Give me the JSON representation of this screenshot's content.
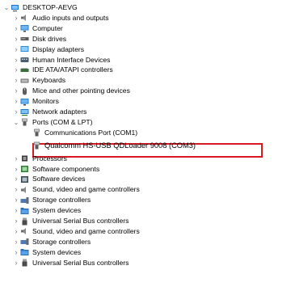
{
  "device_manager": {
    "root": {
      "label": "DESKTOP-AEVG",
      "icon": "computer-icon",
      "expanded": true
    },
    "items": [
      {
        "label": "Audio inputs and outputs",
        "icon": "speaker-icon",
        "expanded": false
      },
      {
        "label": "Computer",
        "icon": "monitor-icon",
        "expanded": false
      },
      {
        "label": "Disk drives",
        "icon": "disk-drive-icon",
        "expanded": false
      },
      {
        "label": "Display adapters",
        "icon": "display-adapter-icon",
        "expanded": false
      },
      {
        "label": "Human Interface Devices",
        "icon": "hid-icon",
        "expanded": false
      },
      {
        "label": "IDE ATA/ATAPI controllers",
        "icon": "ide-controller-icon",
        "expanded": false
      },
      {
        "label": "Keyboards",
        "icon": "keyboard-icon",
        "expanded": false
      },
      {
        "label": "Mice and other pointing devices",
        "icon": "mouse-icon",
        "expanded": false
      },
      {
        "label": "Monitors",
        "icon": "monitor-icon",
        "expanded": false
      },
      {
        "label": "Network adapters",
        "icon": "network-icon",
        "expanded": false
      },
      {
        "label": "Ports (COM & LPT)",
        "icon": "port-icon",
        "expanded": true,
        "children": [
          {
            "label": "Communications Port (COM1)",
            "icon": "port-icon"
          },
          {
            "label": "Qualcomm HS-USB QDLoader 9008 (COM3)",
            "icon": "port-icon",
            "highlighted": true
          }
        ]
      },
      {
        "label": "Processors",
        "icon": "processor-icon",
        "expanded": false
      },
      {
        "label": "Software components",
        "icon": "software-component-icon",
        "expanded": false
      },
      {
        "label": "Software devices",
        "icon": "software-device-icon",
        "expanded": false
      },
      {
        "label": "Sound, video and game controllers",
        "icon": "speaker-icon",
        "expanded": false
      },
      {
        "label": "Storage controllers",
        "icon": "storage-controller-icon",
        "expanded": false
      },
      {
        "label": "System devices",
        "icon": "system-folder-icon",
        "expanded": false
      },
      {
        "label": "Universal Serial Bus controllers",
        "icon": "usb-icon",
        "expanded": false
      },
      {
        "label": "Sound, video and game controllers",
        "icon": "speaker-icon",
        "expanded": false
      },
      {
        "label": "Storage controllers",
        "icon": "storage-controller-icon",
        "expanded": false
      },
      {
        "label": "System devices",
        "icon": "system-folder-icon",
        "expanded": false
      },
      {
        "label": "Universal Serial Bus controllers",
        "icon": "usb-icon",
        "expanded": false
      }
    ],
    "highlight_color": "#d71920",
    "chevron_collapsed": "›",
    "chevron_expanded": "⌄"
  }
}
